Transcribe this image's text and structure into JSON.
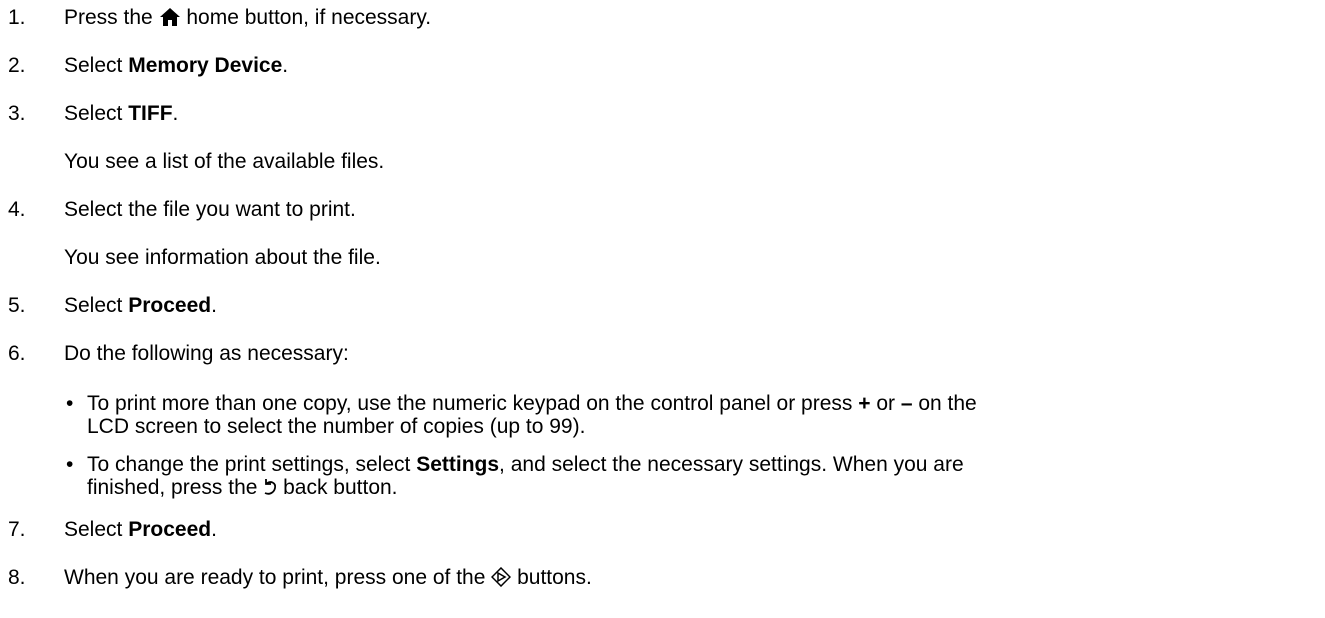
{
  "steps": [
    {
      "num": "1.",
      "before": "Press the ",
      "icon": "home-icon",
      "after": " home button, if necessary."
    },
    {
      "num": "2.",
      "before": "Select ",
      "bold": "Memory Device",
      "after": "."
    },
    {
      "num": "3.",
      "before": "Select ",
      "bold": "TIFF",
      "after": ".",
      "note": "You see a list of the available files."
    },
    {
      "num": "4.",
      "text": "Select the file you want to print.",
      "note": "You see information about the file."
    },
    {
      "num": "5.",
      "before": "Select ",
      "bold": "Proceed",
      "after": "."
    },
    {
      "num": "6.",
      "text": "Do the following as necessary:"
    },
    {
      "num": "7.",
      "before": "Select ",
      "bold": "Proceed",
      "after": "."
    },
    {
      "num": "8.",
      "before": "When you are ready to print, press one of the ",
      "icon": "start-icon",
      "after": " buttons."
    }
  ],
  "bullets": [
    {
      "a": "To print more than one copy, use the numeric keypad on the control panel or press ",
      "plus": "+",
      "or": " or ",
      "minus": "–",
      "b": " on the",
      "line2": "LCD screen to select the number of copies (up to 99)."
    },
    {
      "a": "To change the print settings, select ",
      "bold": "Settings",
      "b": ", and select the necessary settings. When you are",
      "line2_before": "finished, press the ",
      "icon": "back-icon",
      "line2_after": " back button."
    }
  ],
  "bullet_char": "•"
}
